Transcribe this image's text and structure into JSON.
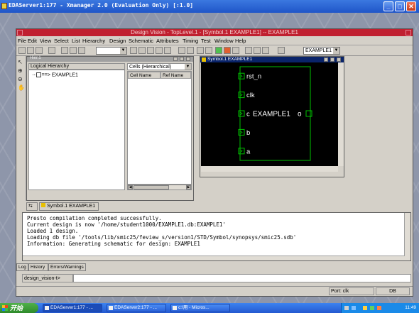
{
  "xmanager": {
    "title": "EDAServer1:177 - Xmanager 2.0 (Evaluation Only) [:1.0]",
    "buttons": {
      "minimize": "_",
      "maximize": "□",
      "close": "✕"
    }
  },
  "design_vision": {
    "title": "Design Vision - TopLevel.1 - [Symbol.1   EXAMPLE1] -- EXAMPLE1",
    "menu": [
      "File",
      "Edit",
      "View",
      "Select",
      "List",
      "Hierarchy",
      "Design",
      "Schematic",
      "Attributes",
      "Timing",
      "Test",
      "Window",
      "Help"
    ],
    "toolbar_design_combo": "EXAMPLE1"
  },
  "hierarchy_window": {
    "title": "Hier.1",
    "logical_hierarchy_header": "Logical Hierarchy",
    "tree_item": "==> EXAMPLE1",
    "cells_combo": "Cells (Hierarchical)",
    "cells_columns": [
      "Cell Name",
      "Ref Name"
    ]
  },
  "symbol_window": {
    "title": "Symbol.1   EXAMPLE1",
    "cell_name": "EXAMPLE1",
    "input_ports": [
      "rst_n",
      "clk",
      "c",
      "b",
      "a"
    ],
    "output_ports": [
      "o"
    ],
    "colors": {
      "background": "#000000",
      "outline": "#00c000",
      "text": "#ffffff"
    }
  },
  "view_tabs": [
    "Symbol.1   EXAMPLE1"
  ],
  "console": {
    "lines": [
      "Presto compilation completed successfully.",
      "Current design is now '/home/student1000/EXAMPLE1.db:EXAMPLE1'",
      "Loaded 1 design.",
      "Loading db file '/tools/lib/smic25/feview_s/version1/STD/Symbol/synopsys/smic25.sdb'",
      "Information: Generating schematic for design: EXAMPLE1"
    ],
    "tabs": [
      "Log",
      "History",
      "Errors/Warnings"
    ],
    "prompt": "design_vision-t>"
  },
  "status": {
    "port": "Port: clk",
    "right": "DB"
  },
  "taskbar": {
    "start": "开始",
    "tasks": [
      "EDAServer1:177 - ...",
      "EDAServer2:177 - ...",
      "c:\\用 - Micros..."
    ],
    "clock": "11:49"
  }
}
